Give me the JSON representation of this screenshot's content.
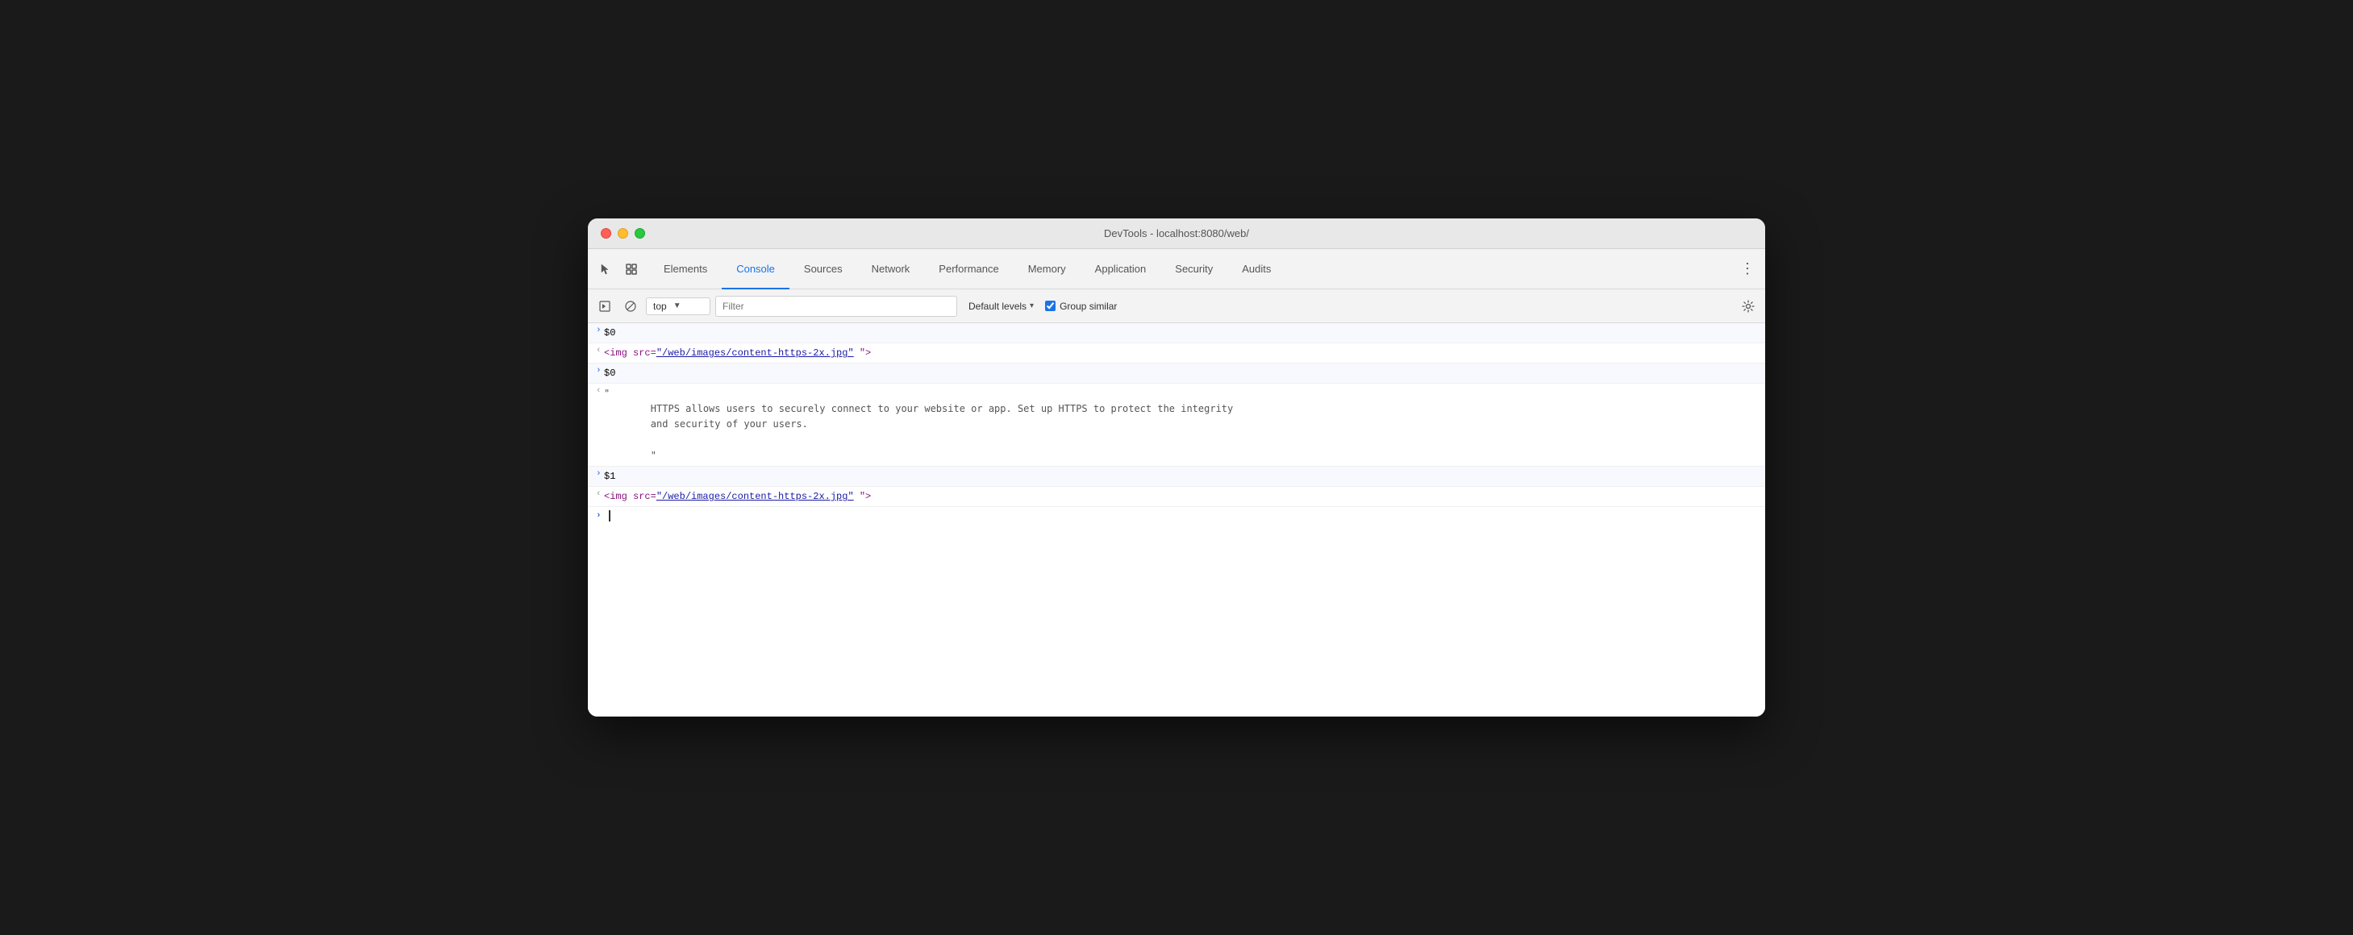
{
  "window": {
    "title": "DevTools - localhost:8080/web/"
  },
  "tabs": {
    "toolbar_icons": [
      "cursor-icon",
      "layers-icon"
    ],
    "items": [
      {
        "id": "elements",
        "label": "Elements",
        "active": false
      },
      {
        "id": "console",
        "label": "Console",
        "active": true
      },
      {
        "id": "sources",
        "label": "Sources",
        "active": false
      },
      {
        "id": "network",
        "label": "Network",
        "active": false
      },
      {
        "id": "performance",
        "label": "Performance",
        "active": false
      },
      {
        "id": "memory",
        "label": "Memory",
        "active": false
      },
      {
        "id": "application",
        "label": "Application",
        "active": false
      },
      {
        "id": "security",
        "label": "Security",
        "active": false
      },
      {
        "id": "audits",
        "label": "Audits",
        "active": false
      }
    ],
    "more_label": "⋮"
  },
  "console_toolbar": {
    "execute_icon": "▶",
    "clear_icon": "🚫",
    "context_label": "top",
    "context_arrow": "▼",
    "filter_placeholder": "Filter",
    "levels_label": "Default levels",
    "levels_arrow": "▾",
    "group_similar_label": "Group similar",
    "group_similar_checked": true,
    "settings_icon": "⚙"
  },
  "console_entries": [
    {
      "type": "input",
      "arrow": ">",
      "content": "$0"
    },
    {
      "type": "output",
      "arrow": "<",
      "parts": [
        {
          "type": "tag_open",
          "text": "<img src="
        },
        {
          "type": "link",
          "text": "\"/web/images/content-https-2x.jpg\""
        },
        {
          "type": "tag_rest",
          "text": " \">"
        }
      ]
    },
    {
      "type": "input",
      "arrow": ">",
      "content": "$0"
    },
    {
      "type": "output_multiline",
      "arrow": "<",
      "lines": [
        "\"",
        "        HTTPS allows users to securely connect to your website or app. Set up HTTPS to protect the integrity",
        "        and security of your users.",
        "",
        "        \""
      ]
    },
    {
      "type": "input",
      "arrow": ">",
      "content": "$1"
    },
    {
      "type": "output",
      "arrow": "<",
      "parts": [
        {
          "type": "tag_open",
          "text": "<img src="
        },
        {
          "type": "link",
          "text": "\"/web/images/content-https-2x.jpg\""
        },
        {
          "type": "tag_rest",
          "text": " \">"
        }
      ]
    },
    {
      "type": "cursor_line"
    }
  ],
  "colors": {
    "active_tab": "#1a73e8",
    "tag_color": "#881280",
    "attr_name_color": "#994500",
    "attr_value_color": "#1a1aa6",
    "link_color": "#1a1aa6"
  }
}
